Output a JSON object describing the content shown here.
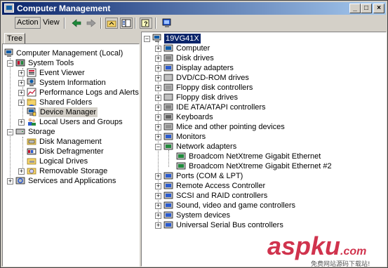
{
  "window": {
    "title": "Computer Management"
  },
  "caption_buttons": {
    "minimize": "_",
    "maximize": "□",
    "close": "×"
  },
  "menu": {
    "action": "Action",
    "view": "View"
  },
  "toolbar": {
    "buttons": [
      "back-icon",
      "forward-icon",
      "up-folder-icon",
      "show-hide-tree-icon",
      "help-icon",
      "properties-icon"
    ]
  },
  "tabs": {
    "tree": "Tree"
  },
  "tree": {
    "root": "Computer Management (Local)",
    "system_tools": "System Tools",
    "event_viewer": "Event Viewer",
    "system_information": "System Information",
    "perf_logs": "Performance Logs and Alerts",
    "shared_folders": "Shared Folders",
    "device_manager": "Device Manager",
    "local_users": "Local Users and Groups",
    "storage": "Storage",
    "disk_management": "Disk Management",
    "disk_defrag": "Disk Defragmenter",
    "logical_drives": "Logical Drives",
    "removable_storage": "Removable Storage",
    "services_apps": "Services and Applications"
  },
  "devices": {
    "root": "19VG41X",
    "items": [
      "Computer",
      "Disk drives",
      "Display adapters",
      "DVD/CD-ROM drives",
      "Floppy disk controllers",
      "Floppy disk drives",
      "IDE ATA/ATAPI controllers",
      "Keyboards",
      "Mice and other pointing devices",
      "Monitors",
      "Network adapters"
    ],
    "network_children": [
      "Broadcom NetXtreme Gigabit Ethernet",
      "Broadcom NetXtreme Gigabit Ethernet #2"
    ],
    "items_after": [
      "Ports (COM & LPT)",
      "Remote Access Controller",
      "SCSI and RAID controllers",
      "Sound, video and game controllers",
      "System devices",
      "Universal Serial Bus controllers"
    ]
  },
  "watermark": {
    "brand": "aspku",
    "tld": ".com",
    "tagline": "免费网站源码下载站!"
  }
}
